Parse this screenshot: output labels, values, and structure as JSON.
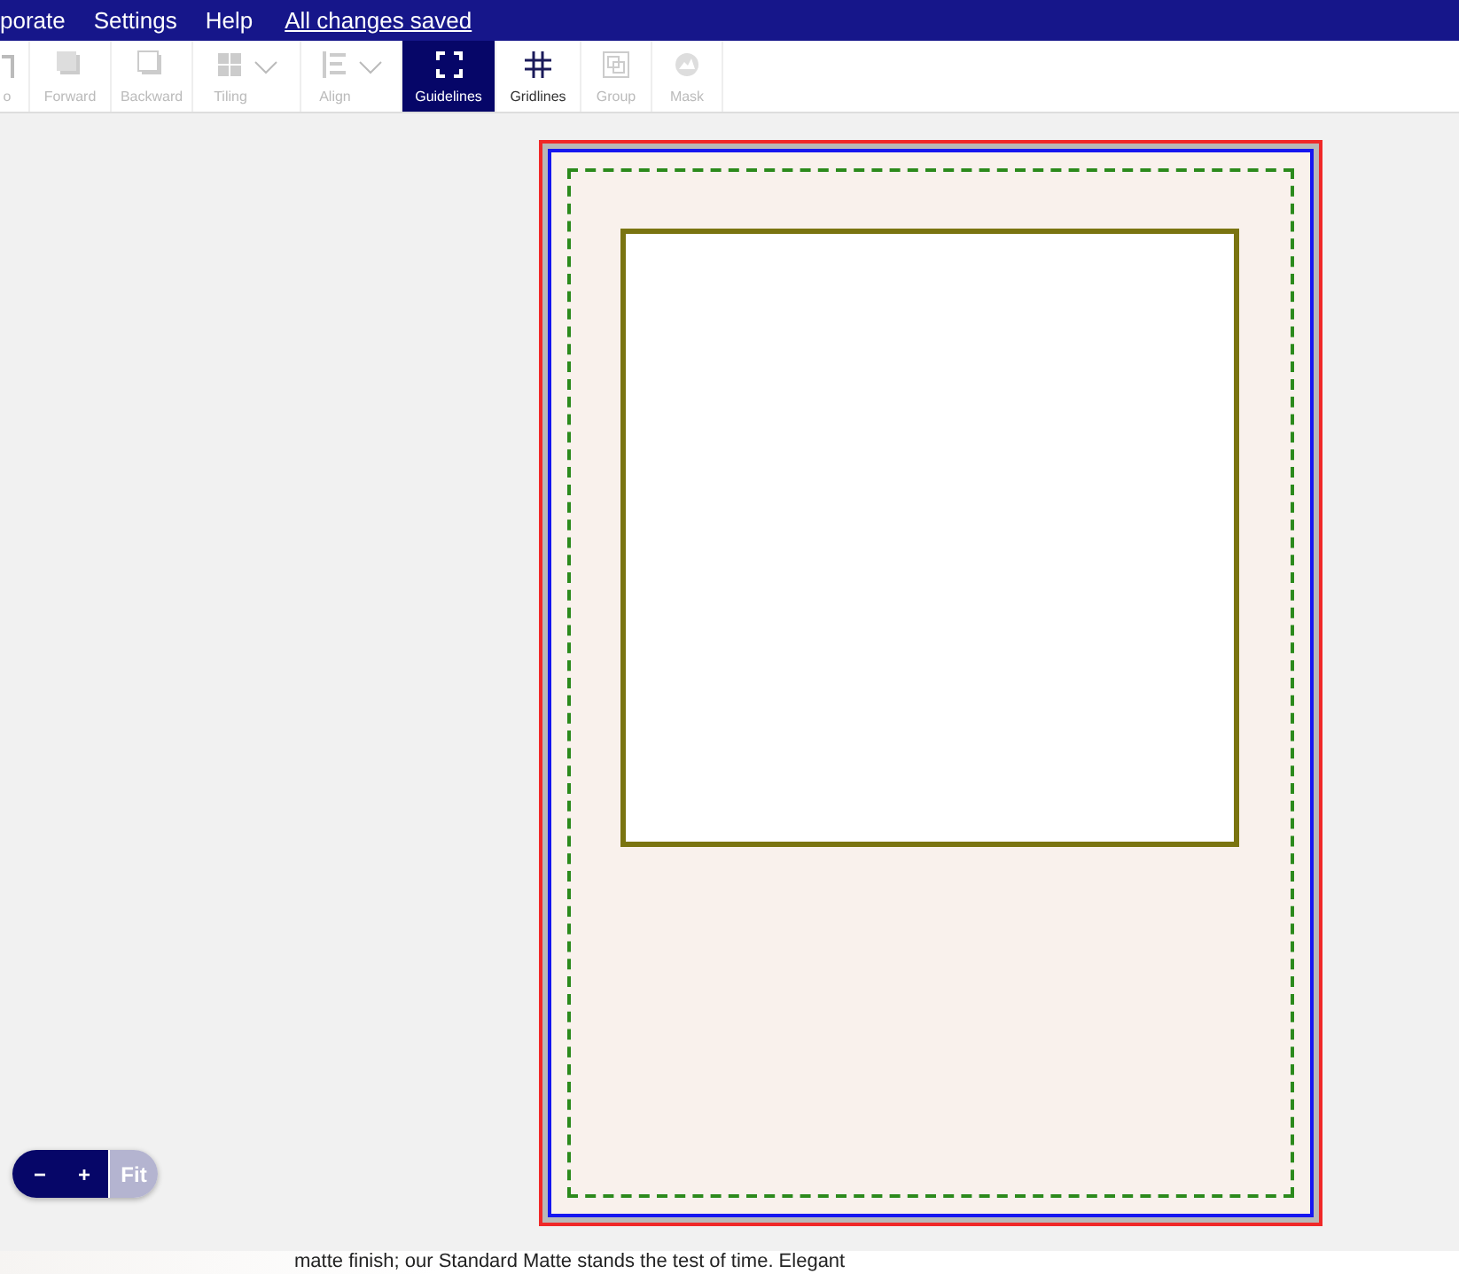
{
  "menu_bar": {
    "items": [
      "porate",
      "Settings",
      "Help"
    ],
    "save_status": "All changes saved"
  },
  "toolbar": {
    "items": [
      {
        "label": "o",
        "kind": "redo",
        "disabled": true,
        "selected": false,
        "has_menu": false
      },
      {
        "label": "Forward",
        "kind": "forward",
        "disabled": true,
        "selected": false,
        "has_menu": false
      },
      {
        "label": "Backward",
        "kind": "backward",
        "disabled": true,
        "selected": false,
        "has_menu": false
      },
      {
        "label": "Tiling",
        "kind": "tiling",
        "disabled": true,
        "selected": false,
        "has_menu": true
      },
      {
        "label": "Align",
        "kind": "align",
        "disabled": true,
        "selected": false,
        "has_menu": true
      },
      {
        "label": "Guidelines",
        "kind": "guidelines",
        "disabled": false,
        "selected": true,
        "has_menu": false
      },
      {
        "label": "Gridlines",
        "kind": "gridlines",
        "disabled": false,
        "selected": false,
        "has_menu": false
      },
      {
        "label": "Group",
        "kind": "group",
        "disabled": true,
        "selected": false,
        "has_menu": false
      },
      {
        "label": "Mask",
        "kind": "mask",
        "disabled": true,
        "selected": false,
        "has_menu": false
      }
    ]
  },
  "zoom_control": {
    "zoom_out": "−",
    "zoom_in": "+",
    "fit": {
      "label": "Fit",
      "disabled": true
    }
  },
  "description": "matte finish; our Standard Matte stands the test of time. Elegant"
}
